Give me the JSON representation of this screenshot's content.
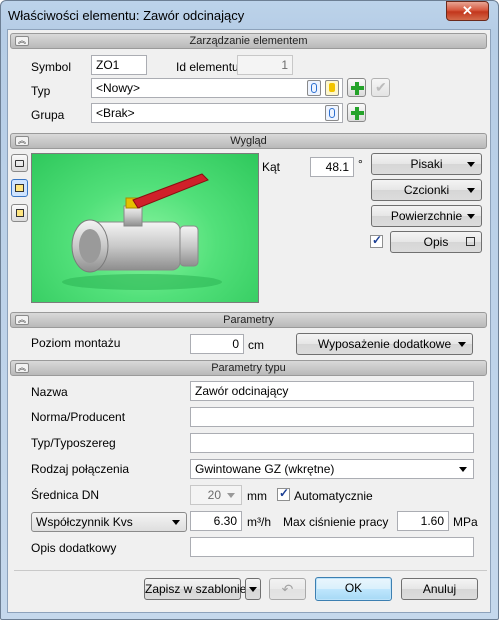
{
  "window": {
    "title": "Właściwości elementu: Zawór odcinający",
    "close_glyph": "✕"
  },
  "sections": {
    "management": "Zarządzanie elementem",
    "appearance": "Wygląd",
    "parameters": "Parametry",
    "type_parameters": "Parametry typu"
  },
  "management": {
    "symbol_label": "Symbol",
    "symbol_value": "ZO1",
    "id_label": "Id elementu",
    "id_value": "1",
    "type_label": "Typ",
    "type_value": "<Nowy>",
    "group_label": "Grupa",
    "group_value": "<Brak>"
  },
  "appearance": {
    "angle_label": "Kąt",
    "angle_value": "48.1",
    "angle_unit": "°",
    "pens_button": "Pisaki",
    "fonts_button": "Czcionki",
    "surfaces_button": "Powierzchnie",
    "description_button": "Opis",
    "description_checked": true
  },
  "parameters": {
    "mount_level_label": "Poziom montażu",
    "mount_level_value": "0",
    "mount_level_unit": "cm",
    "extra_equipment_button": "Wyposażenie dodatkowe"
  },
  "type_parameters": {
    "name_label": "Nazwa",
    "name_value": "Zawór odcinający",
    "standard_label": "Norma/Producent",
    "standard_value": "",
    "series_label": "Typ/Typoszereg",
    "series_value": "",
    "connection_label": "Rodzaj połączenia",
    "connection_value": "Gwintowane GZ (wkrętne)",
    "diameter_label": "Średnica DN",
    "diameter_value": "20",
    "diameter_unit": "mm",
    "automatic_label": "Automatycznie",
    "automatic_checked": true,
    "kvs_select": "Współczynnik Kvs",
    "kvs_value": "6.30",
    "kvs_unit": "m³/h",
    "max_pressure_label": "Max ciśnienie pracy",
    "max_pressure_value": "1.60",
    "max_pressure_unit": "MPa",
    "extra_description_label": "Opis dodatkowy",
    "extra_description_value": ""
  },
  "footer": {
    "save_template_button": "Zapisz w szablonie",
    "ok_button": "OK",
    "cancel_button": "Anuluj"
  },
  "colors": {
    "accent_green": "#25a32a",
    "preview_background": "#52e07a",
    "valve_handle": "#d0202a"
  }
}
